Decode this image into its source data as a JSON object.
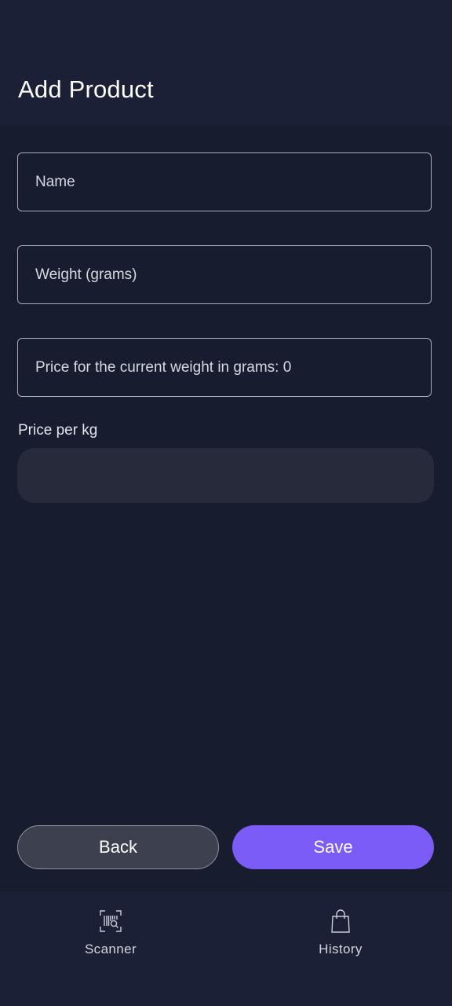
{
  "header": {
    "title": "Add Product"
  },
  "form": {
    "name_placeholder": "Name",
    "name_value": "",
    "weight_placeholder": "Weight (grams)",
    "weight_value": "",
    "price_placeholder": "Price for the current weight in grams: 0",
    "price_value": "",
    "price_per_kg_label": "Price per kg",
    "price_per_kg_value": ""
  },
  "actions": {
    "back_label": "Back",
    "save_label": "Save"
  },
  "bottom_nav": {
    "items": [
      {
        "label": "Scanner",
        "icon": "barcode-scanner-icon"
      },
      {
        "label": "History",
        "icon": "shopping-bag-icon"
      }
    ]
  },
  "colors": {
    "background": "#181c2f",
    "app_bar": "#1b2036",
    "accent": "#7b5cf6",
    "back_button": "#3d404e",
    "input_border": "#a7abb8",
    "readonly_box": "#262a3a"
  }
}
